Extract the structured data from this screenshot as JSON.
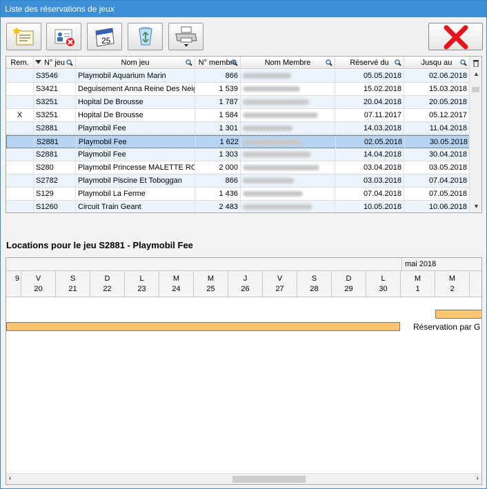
{
  "window": {
    "title": "Liste des réservations de jeux"
  },
  "toolbar": {
    "buttons": [
      {
        "name": "new-reservation-button",
        "icon": "new-document-icon"
      },
      {
        "name": "delete-member-button",
        "icon": "member-delete-icon"
      },
      {
        "name": "calendar-button",
        "icon": "calendar-icon",
        "text": "25"
      },
      {
        "name": "recycle-bin-button",
        "icon": "recycle-bin-icon"
      },
      {
        "name": "print-button",
        "icon": "printer-icon"
      }
    ],
    "close_icon": "close-icon"
  },
  "grid": {
    "columns": [
      "Rem.",
      "N° jeu",
      "Nom jeu",
      "N° membre",
      "Nom Membre",
      "Réservé du",
      "Jusqu au"
    ],
    "rows": [
      {
        "rem": "",
        "jeu": "S3546",
        "nom": "Playmobil Aquarium Marin",
        "membre": "866",
        "du": "05.05.2018",
        "au": "02.06.2018"
      },
      {
        "rem": "",
        "jeu": "S3421",
        "nom": "Deguisement Anna Reine Des Neiges",
        "membre": "1 539",
        "du": "15.02.2018",
        "au": "15.03.2018"
      },
      {
        "rem": "",
        "jeu": "S3251",
        "nom": "Hopital De Brousse",
        "membre": "1 787",
        "du": "20.04.2018",
        "au": "20.05.2018"
      },
      {
        "rem": "X",
        "jeu": "S3251",
        "nom": "Hopital De Brousse",
        "membre": "1 584",
        "du": "07.11.2017",
        "au": "05.12.2017"
      },
      {
        "rem": "",
        "jeu": "S2881",
        "nom": "Playmobil Fee",
        "membre": "1 301",
        "du": "14.03.2018",
        "au": "11.04.2018"
      },
      {
        "rem": "",
        "jeu": "S2881",
        "nom": "Playmobil Fee",
        "membre": "1 622",
        "du": "02.05.2018",
        "au": "30.05.2018"
      },
      {
        "rem": "",
        "jeu": "S2881",
        "nom": "Playmobil Fee",
        "membre": "1 303",
        "du": "14.04.2018",
        "au": "30.04.2018"
      },
      {
        "rem": "",
        "jeu": "S280",
        "nom": "Playmobil Princesse MALETTE ROSE",
        "membre": "2 000",
        "du": "03.04.2018",
        "au": "03.05.2018"
      },
      {
        "rem": "",
        "jeu": "S2782",
        "nom": "Playmobil Piscine Et Toboggan",
        "membre": "866",
        "du": "03.03.2018",
        "au": "07.04.2018"
      },
      {
        "rem": "",
        "jeu": "S129",
        "nom": "Playmobil La Ferme",
        "membre": "1 436",
        "du": "07.04.2018",
        "au": "07.05.2018"
      },
      {
        "rem": "",
        "jeu": "S1260",
        "nom": "Circuit Train Geant",
        "membre": "2 483",
        "du": "10.05.2018",
        "au": "10.06.2018"
      }
    ],
    "selected_row": 5
  },
  "planning": {
    "title": "Locations pour le jeu S2881 - Playmobil Fee",
    "month": "mai 2018",
    "days": [
      {
        "d": "",
        "n": "9"
      },
      {
        "d": "V",
        "n": "20"
      },
      {
        "d": "S",
        "n": "21"
      },
      {
        "d": "D",
        "n": "22"
      },
      {
        "d": "L",
        "n": "23"
      },
      {
        "d": "M",
        "n": "24"
      },
      {
        "d": "M",
        "n": "25"
      },
      {
        "d": "J",
        "n": "26"
      },
      {
        "d": "V",
        "n": "27"
      },
      {
        "d": "S",
        "n": "28"
      },
      {
        "d": "D",
        "n": "29"
      },
      {
        "d": "L",
        "n": "30"
      },
      {
        "d": "M",
        "n": "1"
      },
      {
        "d": "M",
        "n": "2"
      }
    ],
    "bar_label": "Réservation par G",
    "colors": {
      "bar": "#fec46f",
      "selection": "#b6d4f3",
      "titlebar": "#3c8fd6"
    }
  }
}
